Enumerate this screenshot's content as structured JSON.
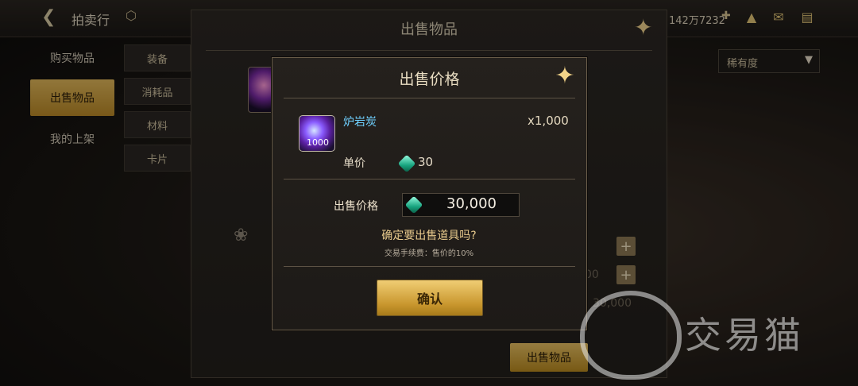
{
  "topbar": {
    "title": "拍卖行",
    "currency": "142万7232",
    "icons": [
      "back-arrow-icon",
      "hexagon-icon",
      "plus-icon",
      "pile-icon",
      "mail-icon",
      "chat-icon"
    ]
  },
  "left_nav": {
    "items": [
      {
        "label": "购买物品"
      },
      {
        "label": "出售物品"
      },
      {
        "label": "我的上架"
      }
    ],
    "active_index": 1
  },
  "sub_nav": {
    "items": [
      {
        "label": "装备"
      },
      {
        "label": "消耗品"
      },
      {
        "label": "材料"
      },
      {
        "label": "卡片"
      }
    ]
  },
  "sell_panel": {
    "title": "出售物品",
    "sell_button": "出售物品",
    "sort_label": "稀有度",
    "ghost_value_1": "00",
    "ghost_value_2": "30,000"
  },
  "modal": {
    "title": "出售价格",
    "item_name": "炉岩炭",
    "item_count": "1000",
    "quantity": "x1,000",
    "unit_price_label": "单价",
    "unit_price": "30",
    "sell_price_label": "出售价格",
    "sell_price": "30,000",
    "confirm_question": "确定要出售道具吗?",
    "fee_note": "交易手续费：售价的10%",
    "confirm_button": "确认"
  },
  "watermark": {
    "text": "交易猫"
  },
  "colors": {
    "gold": "#d9ad4a",
    "item_name": "#6fd0ff"
  }
}
